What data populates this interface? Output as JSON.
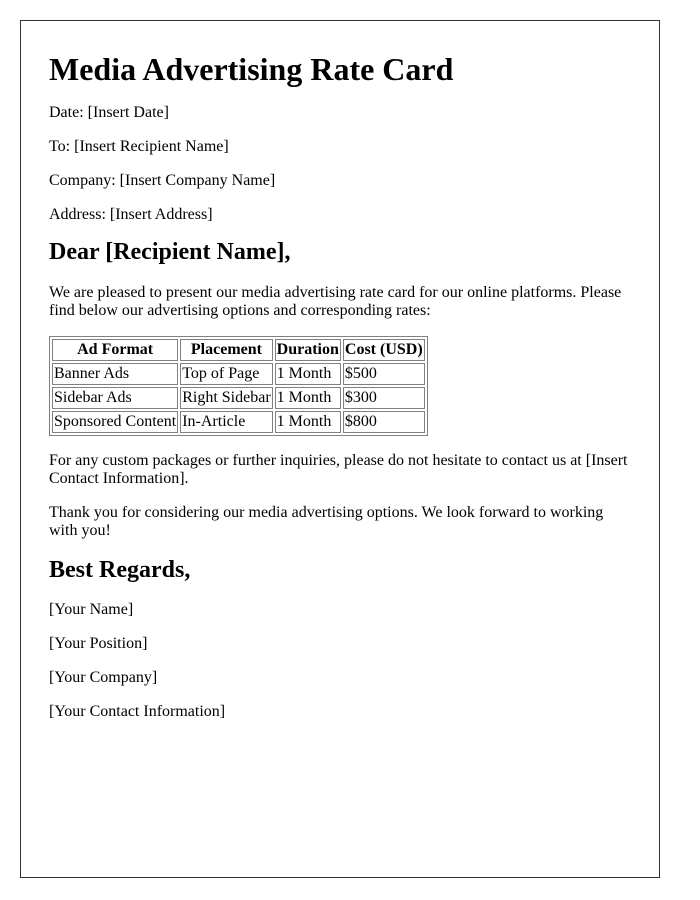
{
  "document": {
    "title": "Media Advertising Rate Card",
    "meta": [
      {
        "label": "Date:",
        "value": "[Insert Date]"
      },
      {
        "label": "To:",
        "value": "[Insert Recipient Name]"
      },
      {
        "label": "Company:",
        "value": "[Insert Company Name]"
      },
      {
        "label": "Address:",
        "value": "[Insert Address]"
      }
    ],
    "greeting": "Dear [Recipient Name],",
    "intro": "We are pleased to present our media advertising rate card for our online platforms. Please find below our advertising options and corresponding rates:",
    "rate_table": {
      "headers": [
        "Ad Format",
        "Placement",
        "Duration",
        "Cost (USD)"
      ],
      "rows": [
        [
          "Banner Ads",
          "Top of Page",
          "1 Month",
          "$500"
        ],
        [
          "Sidebar Ads",
          "Right Sidebar",
          "1 Month",
          "$300"
        ],
        [
          "Sponsored Content",
          "In-Article",
          "1 Month",
          "$800"
        ]
      ]
    },
    "contact_note": "For any custom packages or further inquiries, please do not hesitate to contact us at [Insert Contact Information].",
    "thanks": "Thank you for considering our media advertising options. We look forward to working with you!",
    "closing": "Best Regards,",
    "signature": [
      "[Your Name]",
      "[Your Position]",
      "[Your Company]",
      "[Your Contact Information]"
    ]
  }
}
